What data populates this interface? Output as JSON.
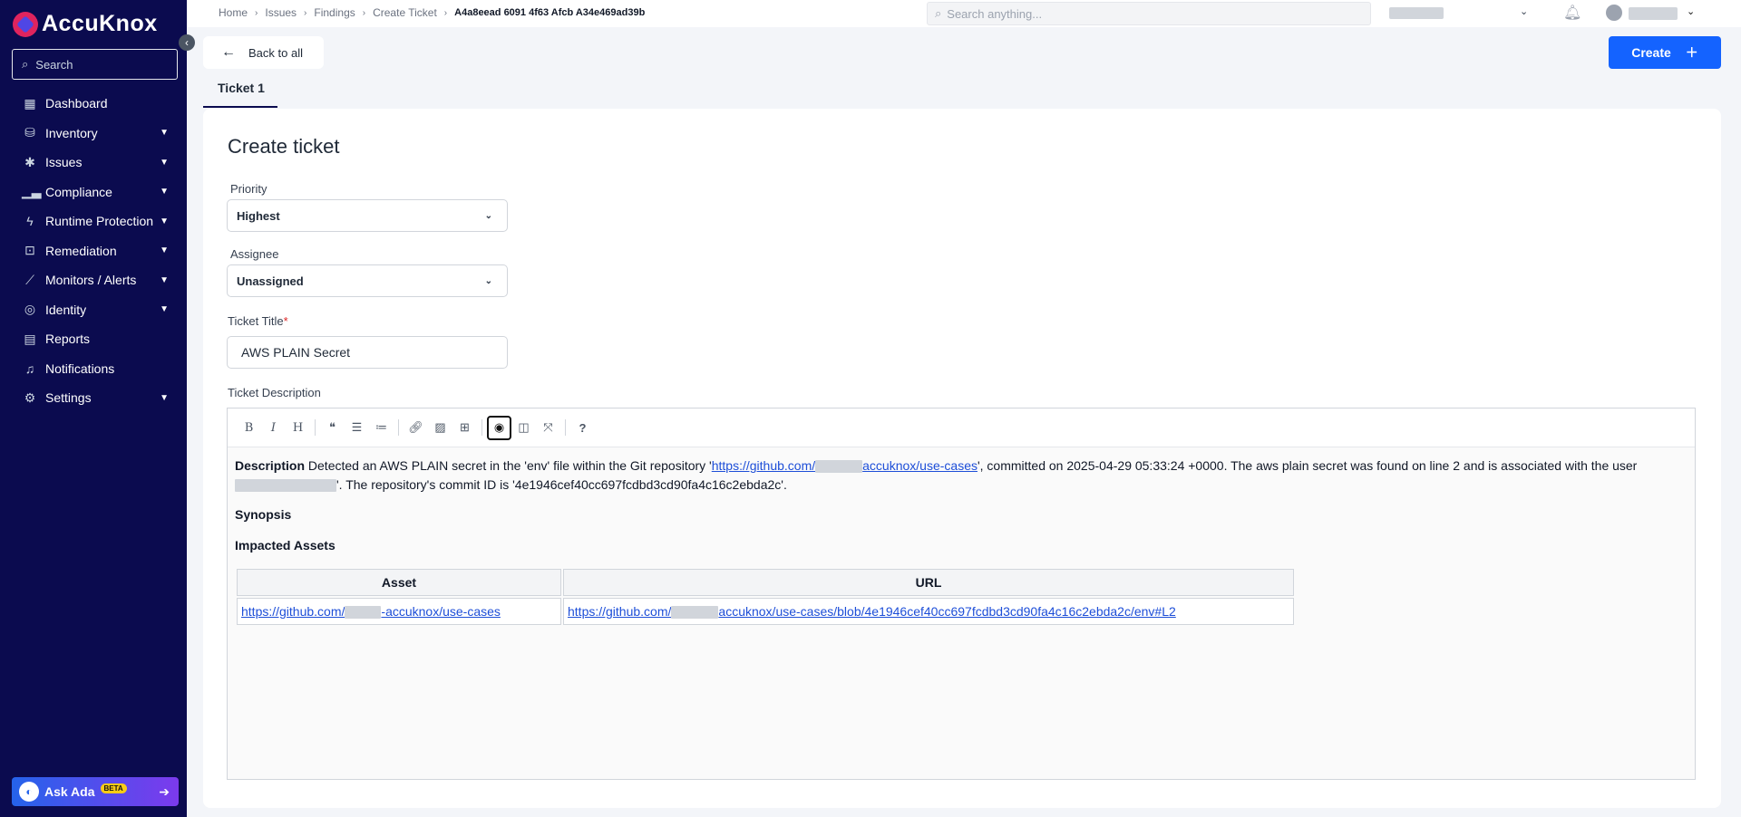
{
  "sidebar": {
    "logo_text": "AccuKnox",
    "search_placeholder": "Search",
    "items": [
      {
        "label": "Dashboard",
        "icon": "grid-icon",
        "has_children": false
      },
      {
        "label": "Inventory",
        "icon": "inventory-icon",
        "has_children": true
      },
      {
        "label": "Issues",
        "icon": "bug-icon",
        "has_children": true
      },
      {
        "label": "Compliance",
        "icon": "chart-icon",
        "has_children": true
      },
      {
        "label": "Runtime Protection",
        "icon": "bolt-icon",
        "has_children": true
      },
      {
        "label": "Remediation",
        "icon": "lock-icon",
        "has_children": true
      },
      {
        "label": "Monitors / Alerts",
        "icon": "trend-icon",
        "has_children": true
      },
      {
        "label": "Identity",
        "icon": "fingerprint-icon",
        "has_children": true
      },
      {
        "label": "Reports",
        "icon": "clipboard-icon",
        "has_children": false
      },
      {
        "label": "Notifications",
        "icon": "bell-icon",
        "has_children": false
      },
      {
        "label": "Settings",
        "icon": "gear-icon",
        "has_children": true
      }
    ],
    "ask_ada": {
      "label": "Ask Ada",
      "badge": "BETA"
    }
  },
  "header": {
    "breadcrumbs": [
      "Home",
      "Issues",
      "Findings",
      "Create Ticket"
    ],
    "current_crumb": "A4a8eead 6091 4f63 Afcb A34e469ad39b",
    "search_placeholder": "Search anything..."
  },
  "main": {
    "back_label": "Back to all",
    "create_label": "Create",
    "tab_label": "Ticket 1",
    "form_title": "Create ticket",
    "priority": {
      "label": "Priority",
      "value": "Highest"
    },
    "assignee": {
      "label": "Assignee",
      "value": "Unassigned"
    },
    "ticket_title": {
      "label": "Ticket Title",
      "required_mark": "*",
      "value": "AWS PLAIN Secret"
    },
    "ticket_description_label": "Ticket Description"
  },
  "editor": {
    "description": {
      "heading": "Description",
      "text_1": " Detected an AWS PLAIN secret in the 'env' file within the Git repository '",
      "link_start": "https://github.com/",
      "link_end": "accuknox/use-cases",
      "text_2": "', committed on 2025-04-29 05:33:24 +0000. The aws plain secret was found on line 2 and is associated with the user ",
      "text_3": "'. The repository's commit ID is '4e1946cef40cc697fcdbd3cd90fa4c16c2ebda2c'."
    },
    "synopsis_heading": "Synopsis",
    "impacted_heading": "Impacted Assets",
    "table": {
      "headers": [
        "Asset",
        "URL"
      ],
      "asset_link_start": "https://github.com/",
      "asset_link_end": "-accuknox/use-cases",
      "url_link_start": "https://github.com/",
      "url_link_end": "accuknox/use-cases/blob/4e1946cef40cc697fcdbd3cd90fa4c16c2ebda2c/env#L2"
    }
  },
  "colors": {
    "sidebar_bg": "#0b0b4f",
    "primary": "#1463ff",
    "link": "#1d4ed8"
  }
}
